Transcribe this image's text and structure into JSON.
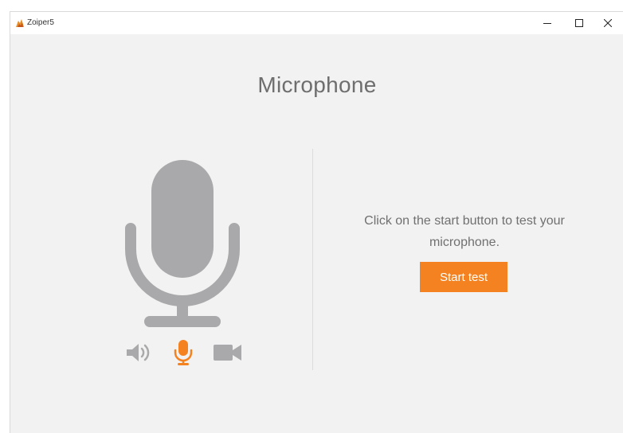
{
  "window": {
    "app_title": "Zoiper5",
    "controls": {
      "minimize": "minimize-icon",
      "maximize": "maximize-icon",
      "close": "close-icon"
    }
  },
  "main": {
    "title": "Microphone",
    "instructions": "Click on the start button to test your microphone.",
    "start_button_label": "Start test"
  },
  "device_tabs": [
    {
      "icon": "speaker-icon",
      "active": false
    },
    {
      "icon": "microphone-icon",
      "active": true
    },
    {
      "icon": "camera-icon",
      "active": false
    }
  ],
  "colors": {
    "accent": "#f58220",
    "icon_gray": "#a9a9ab",
    "background": "#f2f2f2",
    "text": "#707070"
  }
}
